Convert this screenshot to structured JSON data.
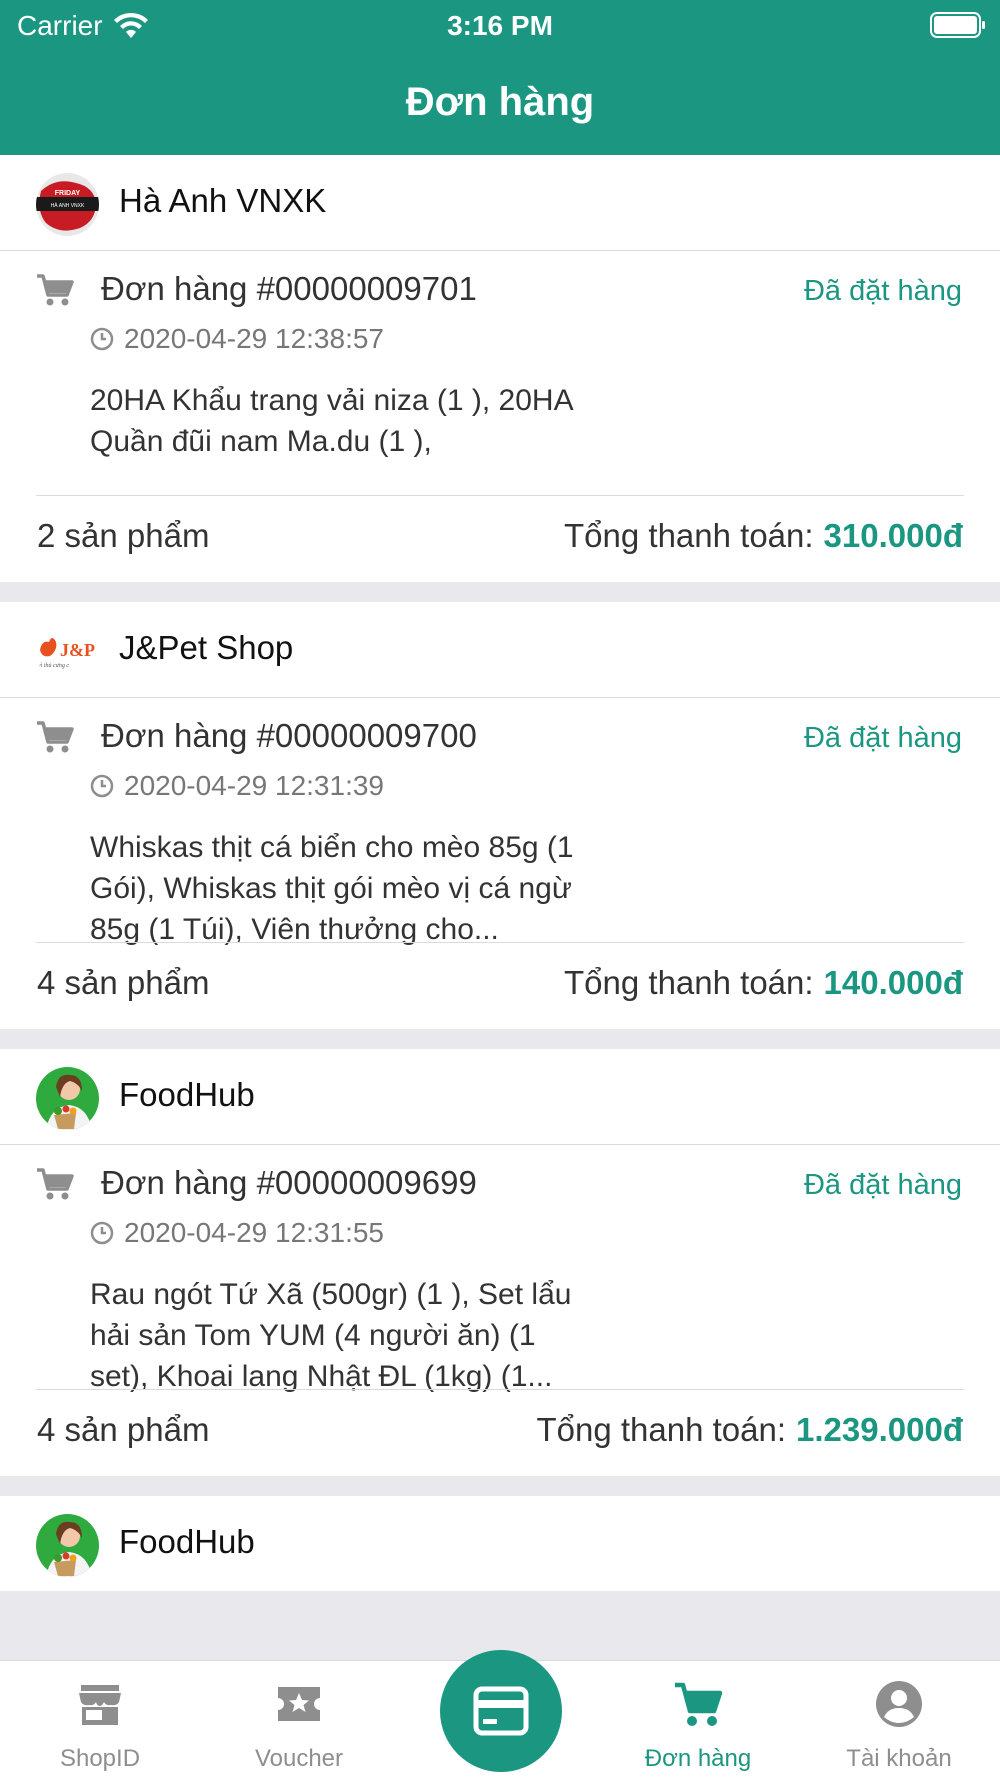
{
  "status_bar": {
    "carrier": "Carrier",
    "time": "3:16 PM"
  },
  "header": {
    "title": "Đơn hàng"
  },
  "orders": [
    {
      "shop": "Hà Anh VNXK",
      "order_no": "Đơn hàng #00000009701",
      "status": "Đã đặt hàng",
      "time": "2020-04-29 12:38:57",
      "line1": "20HA Khẩu trang vải niza (1 ), 20HA",
      "line2": "Quần đũi nam Ma.du (1 ),",
      "line3": "",
      "count": "2 sản phẩm",
      "total_label": "Tổng thanh toán:",
      "total": "310.000đ"
    },
    {
      "shop": "J&Pet Shop",
      "order_no": "Đơn hàng #00000009700",
      "status": "Đã đặt hàng",
      "time": "2020-04-29 12:31:39",
      "line1": "Whiskas thịt cá biển cho mèo 85g (1",
      "line2": "Gói), Whiskas thịt gói mèo vị cá ngừ",
      "line3": "85g (1 Túi), Viên thưởng cho...",
      "count": "4 sản phẩm",
      "total_label": "Tổng thanh toán:",
      "total": "140.000đ"
    },
    {
      "shop": "FoodHub",
      "order_no": "Đơn hàng #00000009699",
      "status": "Đã đặt hàng",
      "time": "2020-04-29 12:31:55",
      "line1": "Rau ngót Tứ Xã (500gr) (1 ), Set lẩu",
      "line2": "hải sản Tom YUM (4 người ăn) (1",
      "line3": "set), Khoai lang Nhật ĐL (1kg) (1...",
      "count": "4 sản phẩm",
      "total_label": "Tổng thanh toán:",
      "total": "1.239.000đ"
    },
    {
      "shop": "FoodHub"
    }
  ],
  "shop_logo_texts": {
    "friday": "FRIDAY",
    "haanh": "HÀ ANH VNXK",
    "jpet": "J&P",
    "jpet_sub": "vì thú cưng c"
  },
  "tabbar": {
    "shopid": "ShopID",
    "voucher": "Voucher",
    "orders": "Đơn hàng",
    "account": "Tài khoản"
  },
  "colors": {
    "primary": "#1b9681",
    "inactive": "#8e8e8e",
    "background": "#e8e8ed"
  }
}
